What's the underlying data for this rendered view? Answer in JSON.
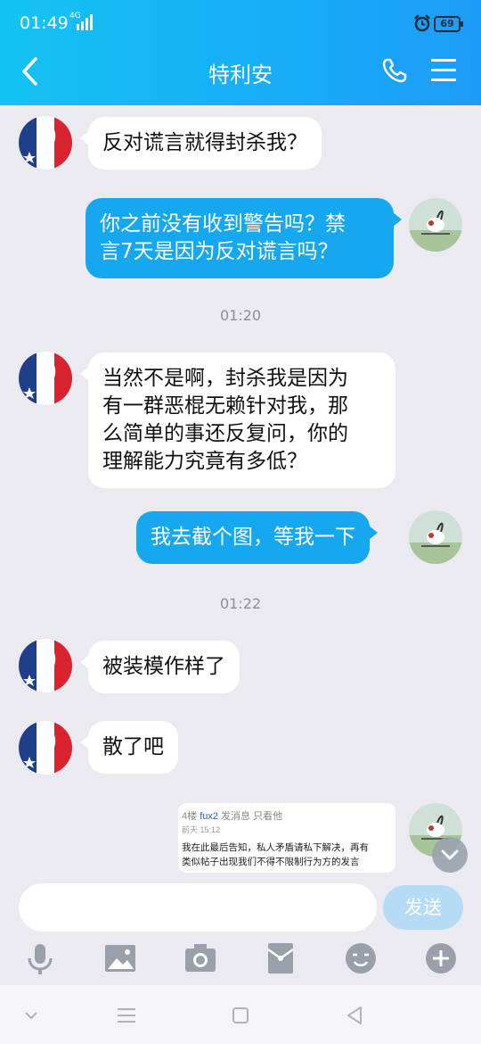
{
  "status_bar": {
    "time": "01:49",
    "network": "4G",
    "battery": "69"
  },
  "header": {
    "title": "特利安",
    "back_icon": "chevron-left-icon",
    "call_icon": "phone-icon",
    "menu_icon": "menu-icon"
  },
  "messages": [
    {
      "side": "left",
      "text": "反对谎言就得封杀我？"
    },
    {
      "side": "right",
      "lines": [
        "你之前没有收到警告吗？禁",
        "言7天是因为反对谎言吗？"
      ]
    },
    {
      "side": "left",
      "lines": [
        "当然不是啊，封杀我是因为",
        "有一群恶棍无赖针对我，那",
        "么简单的事还反复问，你的",
        "理解能力究竟有多低？"
      ]
    },
    {
      "side": "right",
      "text": "我去截个图，等我一下"
    },
    {
      "side": "left",
      "text": "被装模作样了"
    },
    {
      "side": "left",
      "text": "散了吧"
    }
  ],
  "timestamps": [
    "01:20",
    "01:22"
  ],
  "screenshot_card": {
    "floor": "4楼",
    "user": "fux2",
    "actions": "发消息 只看他",
    "time": "前天 15:12",
    "lines": [
      "我在此最后告知，私人矛盾请私下解决，再有",
      "类似帖子出现我们不得不限制行为方的发言"
    ]
  },
  "composer": {
    "placeholder": "",
    "send_label": "发送"
  },
  "toolbar_icons": [
    "microphone-icon",
    "image-icon",
    "camera-icon",
    "red-packet-icon",
    "emoji-icon",
    "plus-icon"
  ],
  "colors": {
    "header_start": "#14c3f3",
    "header_end": "#1c9cf7",
    "bubble_out": "#16a8ef",
    "bubble_in": "#ffffff",
    "background": "#eaeaf0"
  }
}
